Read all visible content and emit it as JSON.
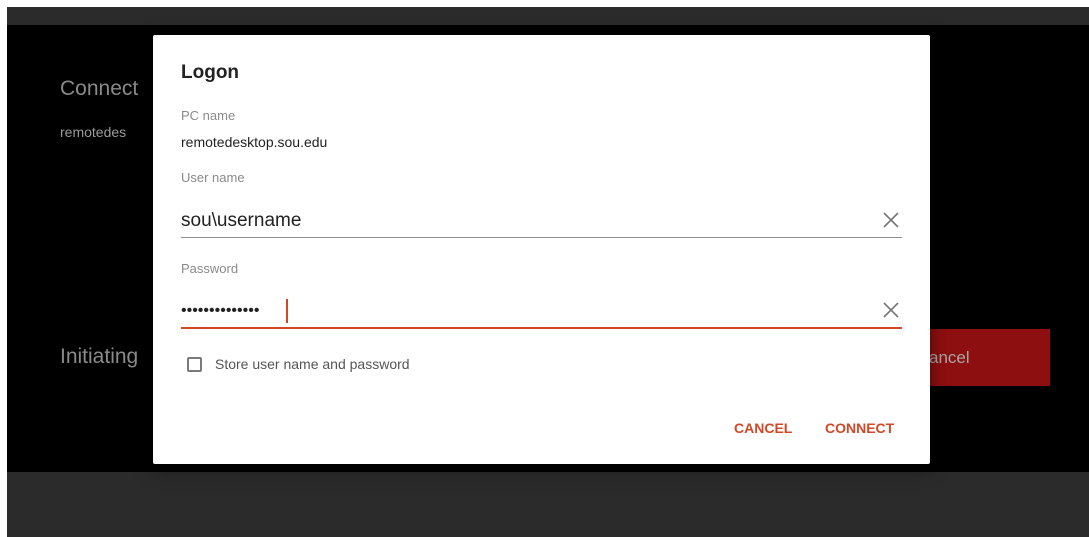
{
  "background": {
    "connecting_title": "Connect",
    "host": "remotedes",
    "initiating": "Initiating",
    "cancel_label": "ancel"
  },
  "dialog": {
    "title": "Logon",
    "pc_name_label": "PC name",
    "pc_name_value": "remotedesktop.sou.edu",
    "user_name_label": "User name",
    "user_name_value": "sou\\username",
    "password_label": "Password",
    "password_value": "••••••••••••••",
    "store_credentials_label": "Store user name and password",
    "store_credentials_checked": false,
    "cancel_label": "CANCEL",
    "connect_label": "CONNECT"
  },
  "icons": {
    "clear_user": "close-icon",
    "clear_password": "close-icon"
  },
  "colors": {
    "accent": "#d24726",
    "background_cancel_button": "#8e0f0f",
    "screen_background": "#000000"
  }
}
